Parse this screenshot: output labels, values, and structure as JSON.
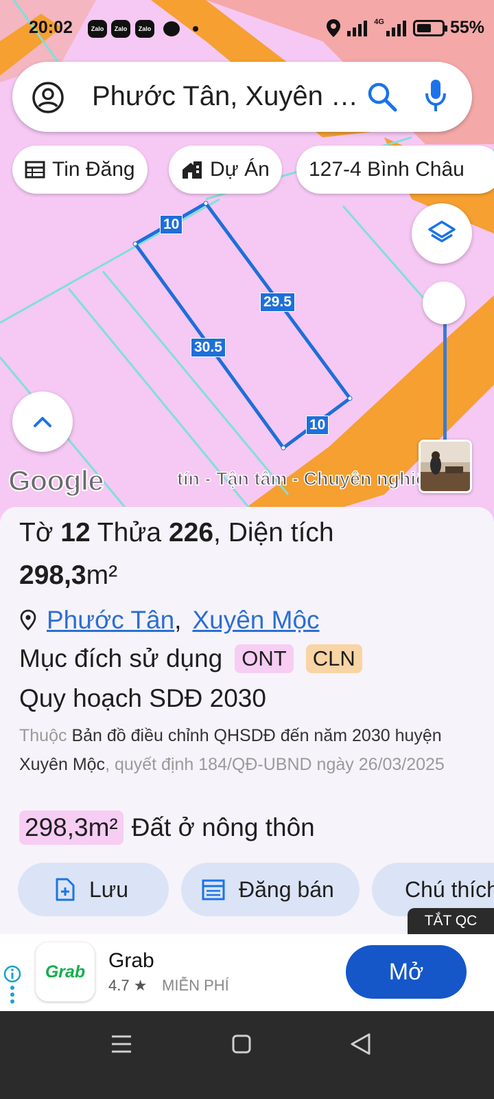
{
  "status_bar": {
    "time": "20:02",
    "notification_apps": [
      "Zalo",
      "Zalo",
      "Zalo"
    ],
    "network": "4G",
    "battery_percent": "55%"
  },
  "search": {
    "value": "Phước Tân, Xuyên Mộc"
  },
  "chips": [
    {
      "label": "Tin Đăng",
      "icon": "table-icon"
    },
    {
      "label": "Dự Án",
      "icon": "building-icon"
    },
    {
      "label": "127-4 Bình Châu",
      "icon": ""
    }
  ],
  "map": {
    "dimensions": {
      "top": "10",
      "right": "29.5",
      "left": "30.5",
      "bottom": "10"
    },
    "logo": "Google",
    "ad_text": "tín - Tận tâm - Chuyên nghiệp"
  },
  "parcel": {
    "sheet_label": "Tờ",
    "sheet_no": "12",
    "plot_label": "Thửa",
    "plot_no": "226",
    "area_label": "Diện tích",
    "area_value": "298,3",
    "area_unit": "m²",
    "ward": "Phước Tân",
    "district": "Xuyên Mộc",
    "purpose_label": "Mục đích sử dụng",
    "purpose_codes": [
      "ONT",
      "CLN"
    ],
    "plan_title": "Quy hoạch SDĐ 2030",
    "plan_desc_prefix": "Thuộc",
    "plan_desc_main": "Bản đồ điều chỉnh QHSDĐ đến năm 2030 huyện Xuyên Mộc",
    "plan_desc_suffix": ", quyết định 184/QĐ-UBND ngày 26/03/2025",
    "zoning_area": "298,3m²",
    "zoning_type": "Đất ở nông thôn"
  },
  "actions": [
    {
      "label": "Lưu",
      "icon": "save-doc-icon"
    },
    {
      "label": "Đăng bán",
      "icon": "calendar-icon"
    },
    {
      "label": "Chú thích",
      "icon": "contrast-icon"
    }
  ],
  "ad_close_label": "TẮT QC",
  "ad": {
    "app_name": "Grab",
    "logo_text": "Grab",
    "rating": "4.7 ★",
    "price": "MIỄN PHÍ",
    "button": "Mở"
  },
  "colors": {
    "map_pink": "#f6c8f4",
    "map_orange": "#f5a030",
    "parcel_line": "#1e6fd9",
    "accent": "#1557c9"
  }
}
